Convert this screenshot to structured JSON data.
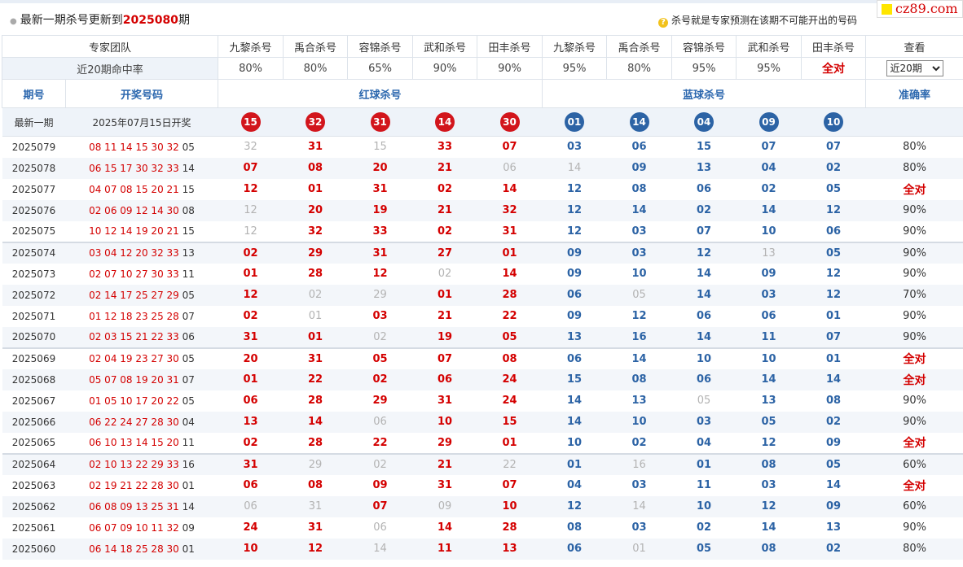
{
  "header": {
    "prefix": "最新一期杀号更新到",
    "issue": "2025080",
    "suffix": "期",
    "hint": "杀号就是专家预测在该期不可能开出的号码",
    "logo": "cz89.com"
  },
  "experts_label": "专家团队",
  "experts": [
    "九黎杀号",
    "禹合杀号",
    "容锦杀号",
    "武和杀号",
    "田丰杀号",
    "九黎杀号",
    "禹合杀号",
    "容锦杀号",
    "武和杀号",
    "田丰杀号"
  ],
  "view_label": "查看",
  "hitrate_label": "近20期命中率",
  "hitrates": [
    "80%",
    "80%",
    "65%",
    "90%",
    "90%",
    "95%",
    "80%",
    "95%",
    "95%",
    "全对"
  ],
  "period_select": {
    "selected": "近20期"
  },
  "sections": {
    "period": "期号",
    "draw": "开奖号码",
    "red": "红球杀号",
    "blue": "蓝球杀号",
    "accuracy": "准确率"
  },
  "latest": {
    "label": "最新一期",
    "draw_date": "2025年07月15日开奖",
    "red": [
      "15",
      "32",
      "31",
      "14",
      "30"
    ],
    "blue": [
      "01",
      "14",
      "04",
      "09",
      "10"
    ]
  },
  "colors": {
    "red_ball": "#d2151c",
    "blue_ball": "#2c63a5",
    "kill_red": "#d40000",
    "kill_blue": "#2c63a5",
    "missed": "#b3b3b3"
  },
  "rows": [
    {
      "period": "2025079",
      "reds": "08 11 14 15 30 32",
      "blue": "05",
      "red_kills": [
        [
          "32",
          0
        ],
        [
          "31",
          1
        ],
        [
          "15",
          0
        ],
        [
          "33",
          1
        ],
        [
          "07",
          1
        ]
      ],
      "blue_kills": [
        [
          "03",
          1
        ],
        [
          "06",
          1
        ],
        [
          "15",
          1
        ],
        [
          "07",
          1
        ],
        [
          "07",
          1
        ]
      ],
      "acc": "80%"
    },
    {
      "period": "2025078",
      "reds": "06 15 17 30 32 33",
      "blue": "14",
      "red_kills": [
        [
          "07",
          1
        ],
        [
          "08",
          1
        ],
        [
          "20",
          1
        ],
        [
          "21",
          1
        ],
        [
          "06",
          0
        ]
      ],
      "blue_kills": [
        [
          "14",
          0
        ],
        [
          "09",
          1
        ],
        [
          "13",
          1
        ],
        [
          "04",
          1
        ],
        [
          "02",
          1
        ]
      ],
      "acc": "80%"
    },
    {
      "period": "2025077",
      "reds": "04 07 08 15 20 21",
      "blue": "15",
      "red_kills": [
        [
          "12",
          1
        ],
        [
          "01",
          1
        ],
        [
          "31",
          1
        ],
        [
          "02",
          1
        ],
        [
          "14",
          1
        ]
      ],
      "blue_kills": [
        [
          "12",
          1
        ],
        [
          "08",
          1
        ],
        [
          "06",
          1
        ],
        [
          "02",
          1
        ],
        [
          "05",
          1
        ]
      ],
      "acc": "全对"
    },
    {
      "period": "2025076",
      "reds": "02 06 09 12 14 30",
      "blue": "08",
      "red_kills": [
        [
          "12",
          0
        ],
        [
          "20",
          1
        ],
        [
          "19",
          1
        ],
        [
          "21",
          1
        ],
        [
          "32",
          1
        ]
      ],
      "blue_kills": [
        [
          "12",
          1
        ],
        [
          "14",
          1
        ],
        [
          "02",
          1
        ],
        [
          "14",
          1
        ],
        [
          "12",
          1
        ]
      ],
      "acc": "90%"
    },
    {
      "period": "2025075",
      "reds": "10 12 14 19 20 21",
      "blue": "15",
      "red_kills": [
        [
          "12",
          0
        ],
        [
          "32",
          1
        ],
        [
          "33",
          1
        ],
        [
          "02",
          1
        ],
        [
          "31",
          1
        ]
      ],
      "blue_kills": [
        [
          "12",
          1
        ],
        [
          "03",
          1
        ],
        [
          "07",
          1
        ],
        [
          "10",
          1
        ],
        [
          "06",
          1
        ]
      ],
      "acc": "90%"
    },
    {
      "period": "2025074",
      "reds": "03 04 12 20 32 33",
      "blue": "13",
      "red_kills": [
        [
          "02",
          1
        ],
        [
          "29",
          1
        ],
        [
          "31",
          1
        ],
        [
          "27",
          1
        ],
        [
          "01",
          1
        ]
      ],
      "blue_kills": [
        [
          "09",
          1
        ],
        [
          "03",
          1
        ],
        [
          "12",
          1
        ],
        [
          "13",
          0
        ],
        [
          "05",
          1
        ]
      ],
      "acc": "90%"
    },
    {
      "period": "2025073",
      "reds": "02 07 10 27 30 33",
      "blue": "11",
      "red_kills": [
        [
          "01",
          1
        ],
        [
          "28",
          1
        ],
        [
          "12",
          1
        ],
        [
          "02",
          0
        ],
        [
          "14",
          1
        ]
      ],
      "blue_kills": [
        [
          "09",
          1
        ],
        [
          "10",
          1
        ],
        [
          "14",
          1
        ],
        [
          "09",
          1
        ],
        [
          "12",
          1
        ]
      ],
      "acc": "90%"
    },
    {
      "period": "2025072",
      "reds": "02 14 17 25 27 29",
      "blue": "05",
      "red_kills": [
        [
          "12",
          1
        ],
        [
          "02",
          0
        ],
        [
          "29",
          0
        ],
        [
          "01",
          1
        ],
        [
          "28",
          1
        ]
      ],
      "blue_kills": [
        [
          "06",
          1
        ],
        [
          "05",
          0
        ],
        [
          "14",
          1
        ],
        [
          "03",
          1
        ],
        [
          "12",
          1
        ]
      ],
      "acc": "70%"
    },
    {
      "period": "2025071",
      "reds": "01 12 18 23 25 28",
      "blue": "07",
      "red_kills": [
        [
          "02",
          1
        ],
        [
          "01",
          0
        ],
        [
          "03",
          1
        ],
        [
          "21",
          1
        ],
        [
          "22",
          1
        ]
      ],
      "blue_kills": [
        [
          "09",
          1
        ],
        [
          "12",
          1
        ],
        [
          "06",
          1
        ],
        [
          "06",
          1
        ],
        [
          "01",
          1
        ]
      ],
      "acc": "90%"
    },
    {
      "period": "2025070",
      "reds": "02 03 15 21 22 33",
      "blue": "06",
      "red_kills": [
        [
          "31",
          1
        ],
        [
          "01",
          1
        ],
        [
          "02",
          0
        ],
        [
          "19",
          1
        ],
        [
          "05",
          1
        ]
      ],
      "blue_kills": [
        [
          "13",
          1
        ],
        [
          "16",
          1
        ],
        [
          "14",
          1
        ],
        [
          "11",
          1
        ],
        [
          "07",
          1
        ]
      ],
      "acc": "90%"
    },
    {
      "period": "2025069",
      "reds": "02 04 19 23 27 30",
      "blue": "05",
      "red_kills": [
        [
          "20",
          1
        ],
        [
          "31",
          1
        ],
        [
          "05",
          1
        ],
        [
          "07",
          1
        ],
        [
          "08",
          1
        ]
      ],
      "blue_kills": [
        [
          "06",
          1
        ],
        [
          "14",
          1
        ],
        [
          "10",
          1
        ],
        [
          "10",
          1
        ],
        [
          "01",
          1
        ]
      ],
      "acc": "全对"
    },
    {
      "period": "2025068",
      "reds": "05 07 08 19 20 31",
      "blue": "07",
      "red_kills": [
        [
          "01",
          1
        ],
        [
          "22",
          1
        ],
        [
          "02",
          1
        ],
        [
          "06",
          1
        ],
        [
          "24",
          1
        ]
      ],
      "blue_kills": [
        [
          "15",
          1
        ],
        [
          "08",
          1
        ],
        [
          "06",
          1
        ],
        [
          "14",
          1
        ],
        [
          "14",
          1
        ]
      ],
      "acc": "全对"
    },
    {
      "period": "2025067",
      "reds": "01 05 10 17 20 22",
      "blue": "05",
      "red_kills": [
        [
          "06",
          1
        ],
        [
          "28",
          1
        ],
        [
          "29",
          1
        ],
        [
          "31",
          1
        ],
        [
          "24",
          1
        ]
      ],
      "blue_kills": [
        [
          "14",
          1
        ],
        [
          "13",
          1
        ],
        [
          "05",
          0
        ],
        [
          "13",
          1
        ],
        [
          "08",
          1
        ]
      ],
      "acc": "90%"
    },
    {
      "period": "2025066",
      "reds": "06 22 24 27 28 30",
      "blue": "04",
      "red_kills": [
        [
          "13",
          1
        ],
        [
          "14",
          1
        ],
        [
          "06",
          0
        ],
        [
          "10",
          1
        ],
        [
          "15",
          1
        ]
      ],
      "blue_kills": [
        [
          "14",
          1
        ],
        [
          "10",
          1
        ],
        [
          "03",
          1
        ],
        [
          "05",
          1
        ],
        [
          "02",
          1
        ]
      ],
      "acc": "90%"
    },
    {
      "period": "2025065",
      "reds": "06 10 13 14 15 20",
      "blue": "11",
      "red_kills": [
        [
          "02",
          1
        ],
        [
          "28",
          1
        ],
        [
          "22",
          1
        ],
        [
          "29",
          1
        ],
        [
          "01",
          1
        ]
      ],
      "blue_kills": [
        [
          "10",
          1
        ],
        [
          "02",
          1
        ],
        [
          "04",
          1
        ],
        [
          "12",
          1
        ],
        [
          "09",
          1
        ]
      ],
      "acc": "全对"
    },
    {
      "period": "2025064",
      "reds": "02 10 13 22 29 33",
      "blue": "16",
      "red_kills": [
        [
          "31",
          1
        ],
        [
          "29",
          0
        ],
        [
          "02",
          0
        ],
        [
          "21",
          1
        ],
        [
          "22",
          0
        ]
      ],
      "blue_kills": [
        [
          "01",
          1
        ],
        [
          "16",
          0
        ],
        [
          "01",
          1
        ],
        [
          "08",
          1
        ],
        [
          "05",
          1
        ]
      ],
      "acc": "60%"
    },
    {
      "period": "2025063",
      "reds": "02 19 21 22 28 30",
      "blue": "01",
      "red_kills": [
        [
          "06",
          1
        ],
        [
          "08",
          1
        ],
        [
          "09",
          1
        ],
        [
          "31",
          1
        ],
        [
          "07",
          1
        ]
      ],
      "blue_kills": [
        [
          "04",
          1
        ],
        [
          "03",
          1
        ],
        [
          "11",
          1
        ],
        [
          "03",
          1
        ],
        [
          "14",
          1
        ]
      ],
      "acc": "全对"
    },
    {
      "period": "2025062",
      "reds": "06 08 09 13 25 31",
      "blue": "14",
      "red_kills": [
        [
          "06",
          0
        ],
        [
          "31",
          0
        ],
        [
          "07",
          1
        ],
        [
          "09",
          0
        ],
        [
          "10",
          1
        ]
      ],
      "blue_kills": [
        [
          "12",
          1
        ],
        [
          "14",
          0
        ],
        [
          "10",
          1
        ],
        [
          "12",
          1
        ],
        [
          "09",
          1
        ]
      ],
      "acc": "60%"
    },
    {
      "period": "2025061",
      "reds": "06 07 09 10 11 32",
      "blue": "09",
      "red_kills": [
        [
          "24",
          1
        ],
        [
          "31",
          1
        ],
        [
          "06",
          0
        ],
        [
          "14",
          1
        ],
        [
          "28",
          1
        ]
      ],
      "blue_kills": [
        [
          "08",
          1
        ],
        [
          "03",
          1
        ],
        [
          "02",
          1
        ],
        [
          "14",
          1
        ],
        [
          "13",
          1
        ]
      ],
      "acc": "90%"
    },
    {
      "period": "2025060",
      "reds": "06 14 18 25 28 30",
      "blue": "01",
      "red_kills": [
        [
          "10",
          1
        ],
        [
          "12",
          1
        ],
        [
          "14",
          0
        ],
        [
          "11",
          1
        ],
        [
          "13",
          1
        ]
      ],
      "blue_kills": [
        [
          "06",
          1
        ],
        [
          "01",
          0
        ],
        [
          "05",
          1
        ],
        [
          "08",
          1
        ],
        [
          "02",
          1
        ]
      ],
      "acc": "80%"
    }
  ]
}
